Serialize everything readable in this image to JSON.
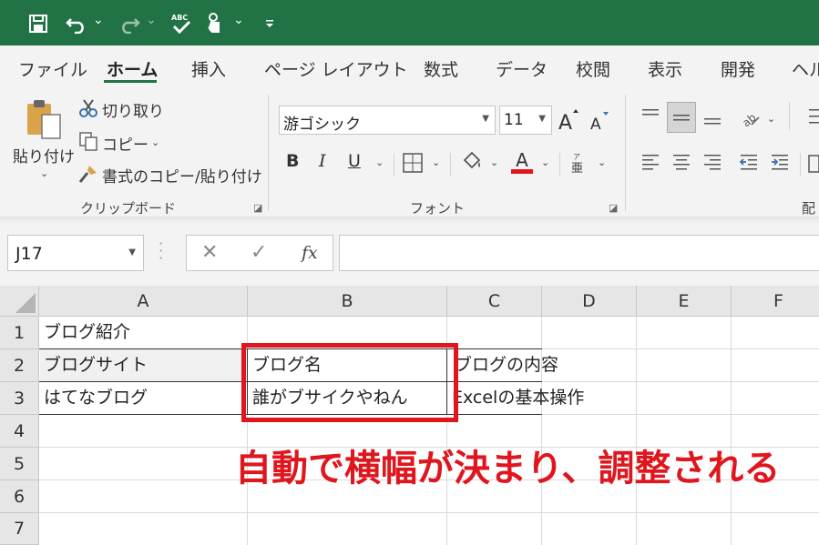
{
  "qat": {
    "icons": [
      "save-icon",
      "undo-icon",
      "redo-icon",
      "spelling-icon",
      "touch-mode-icon",
      "customize-icon"
    ]
  },
  "tabs": [
    "ファイル",
    "ホーム",
    "挿入",
    "ページ レイアウト",
    "数式",
    "データ",
    "校閲",
    "表示",
    "開発",
    "ヘル"
  ],
  "active_tab": "ホーム",
  "ribbon": {
    "clipboard": {
      "paste_label": "貼り付け",
      "cut_label": "切り取り",
      "copy_label": "コピー",
      "format_painter_label": "書式のコピー/貼り付け",
      "group_label": "クリップボード"
    },
    "font": {
      "font_name": "游ゴシック",
      "font_size": "11",
      "bold": "B",
      "italic": "I",
      "underline": "U",
      "font_color_letter": "A",
      "group_label": "フォント"
    },
    "alignment": {
      "group_label_partial": "配"
    }
  },
  "formula_bar": {
    "name_box": "J17",
    "cancel": "✕",
    "enter": "✓",
    "fx": "fx",
    "content": ""
  },
  "grid": {
    "columns": [
      "A",
      "B",
      "C",
      "D",
      "E",
      "F"
    ],
    "rows": [
      "1",
      "2",
      "3",
      "4",
      "5",
      "6",
      "7"
    ],
    "cells": {
      "A1": "ブログ紹介",
      "A2": "ブログサイト",
      "B2": "ブログ名",
      "C2": "ブログの内容",
      "A3": "はてなブログ",
      "B3": "誰がブサイクやねん",
      "C3": "Excelの基本操作"
    }
  },
  "annotation": "自動で横幅が決まり、調整される",
  "colors": {
    "excel_green": "#217346",
    "annotation_red": "#e0161e",
    "font_color_bar": "#e0161e"
  }
}
